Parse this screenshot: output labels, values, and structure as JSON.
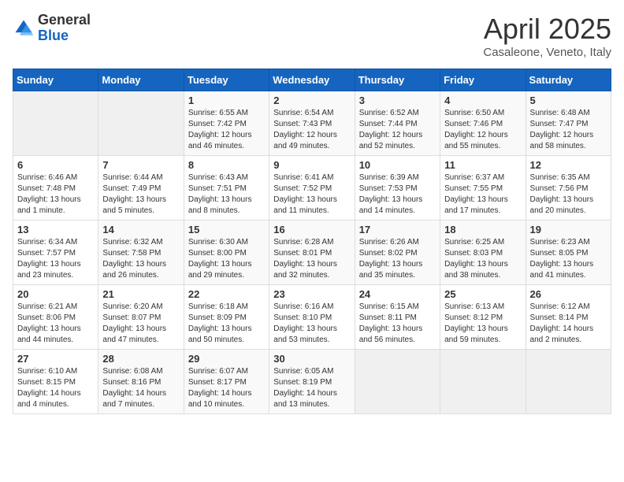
{
  "header": {
    "logo_general": "General",
    "logo_blue": "Blue",
    "title": "April 2025",
    "subtitle": "Casaleone, Veneto, Italy"
  },
  "days_of_week": [
    "Sunday",
    "Monday",
    "Tuesday",
    "Wednesday",
    "Thursday",
    "Friday",
    "Saturday"
  ],
  "weeks": [
    [
      {
        "day": "",
        "info": ""
      },
      {
        "day": "",
        "info": ""
      },
      {
        "day": "1",
        "info": "Sunrise: 6:55 AM\nSunset: 7:42 PM\nDaylight: 12 hours and 46 minutes."
      },
      {
        "day": "2",
        "info": "Sunrise: 6:54 AM\nSunset: 7:43 PM\nDaylight: 12 hours and 49 minutes."
      },
      {
        "day": "3",
        "info": "Sunrise: 6:52 AM\nSunset: 7:44 PM\nDaylight: 12 hours and 52 minutes."
      },
      {
        "day": "4",
        "info": "Sunrise: 6:50 AM\nSunset: 7:46 PM\nDaylight: 12 hours and 55 minutes."
      },
      {
        "day": "5",
        "info": "Sunrise: 6:48 AM\nSunset: 7:47 PM\nDaylight: 12 hours and 58 minutes."
      }
    ],
    [
      {
        "day": "6",
        "info": "Sunrise: 6:46 AM\nSunset: 7:48 PM\nDaylight: 13 hours and 1 minute."
      },
      {
        "day": "7",
        "info": "Sunrise: 6:44 AM\nSunset: 7:49 PM\nDaylight: 13 hours and 5 minutes."
      },
      {
        "day": "8",
        "info": "Sunrise: 6:43 AM\nSunset: 7:51 PM\nDaylight: 13 hours and 8 minutes."
      },
      {
        "day": "9",
        "info": "Sunrise: 6:41 AM\nSunset: 7:52 PM\nDaylight: 13 hours and 11 minutes."
      },
      {
        "day": "10",
        "info": "Sunrise: 6:39 AM\nSunset: 7:53 PM\nDaylight: 13 hours and 14 minutes."
      },
      {
        "day": "11",
        "info": "Sunrise: 6:37 AM\nSunset: 7:55 PM\nDaylight: 13 hours and 17 minutes."
      },
      {
        "day": "12",
        "info": "Sunrise: 6:35 AM\nSunset: 7:56 PM\nDaylight: 13 hours and 20 minutes."
      }
    ],
    [
      {
        "day": "13",
        "info": "Sunrise: 6:34 AM\nSunset: 7:57 PM\nDaylight: 13 hours and 23 minutes."
      },
      {
        "day": "14",
        "info": "Sunrise: 6:32 AM\nSunset: 7:58 PM\nDaylight: 13 hours and 26 minutes."
      },
      {
        "day": "15",
        "info": "Sunrise: 6:30 AM\nSunset: 8:00 PM\nDaylight: 13 hours and 29 minutes."
      },
      {
        "day": "16",
        "info": "Sunrise: 6:28 AM\nSunset: 8:01 PM\nDaylight: 13 hours and 32 minutes."
      },
      {
        "day": "17",
        "info": "Sunrise: 6:26 AM\nSunset: 8:02 PM\nDaylight: 13 hours and 35 minutes."
      },
      {
        "day": "18",
        "info": "Sunrise: 6:25 AM\nSunset: 8:03 PM\nDaylight: 13 hours and 38 minutes."
      },
      {
        "day": "19",
        "info": "Sunrise: 6:23 AM\nSunset: 8:05 PM\nDaylight: 13 hours and 41 minutes."
      }
    ],
    [
      {
        "day": "20",
        "info": "Sunrise: 6:21 AM\nSunset: 8:06 PM\nDaylight: 13 hours and 44 minutes."
      },
      {
        "day": "21",
        "info": "Sunrise: 6:20 AM\nSunset: 8:07 PM\nDaylight: 13 hours and 47 minutes."
      },
      {
        "day": "22",
        "info": "Sunrise: 6:18 AM\nSunset: 8:09 PM\nDaylight: 13 hours and 50 minutes."
      },
      {
        "day": "23",
        "info": "Sunrise: 6:16 AM\nSunset: 8:10 PM\nDaylight: 13 hours and 53 minutes."
      },
      {
        "day": "24",
        "info": "Sunrise: 6:15 AM\nSunset: 8:11 PM\nDaylight: 13 hours and 56 minutes."
      },
      {
        "day": "25",
        "info": "Sunrise: 6:13 AM\nSunset: 8:12 PM\nDaylight: 13 hours and 59 minutes."
      },
      {
        "day": "26",
        "info": "Sunrise: 6:12 AM\nSunset: 8:14 PM\nDaylight: 14 hours and 2 minutes."
      }
    ],
    [
      {
        "day": "27",
        "info": "Sunrise: 6:10 AM\nSunset: 8:15 PM\nDaylight: 14 hours and 4 minutes."
      },
      {
        "day": "28",
        "info": "Sunrise: 6:08 AM\nSunset: 8:16 PM\nDaylight: 14 hours and 7 minutes."
      },
      {
        "day": "29",
        "info": "Sunrise: 6:07 AM\nSunset: 8:17 PM\nDaylight: 14 hours and 10 minutes."
      },
      {
        "day": "30",
        "info": "Sunrise: 6:05 AM\nSunset: 8:19 PM\nDaylight: 14 hours and 13 minutes."
      },
      {
        "day": "",
        "info": ""
      },
      {
        "day": "",
        "info": ""
      },
      {
        "day": "",
        "info": ""
      }
    ]
  ]
}
